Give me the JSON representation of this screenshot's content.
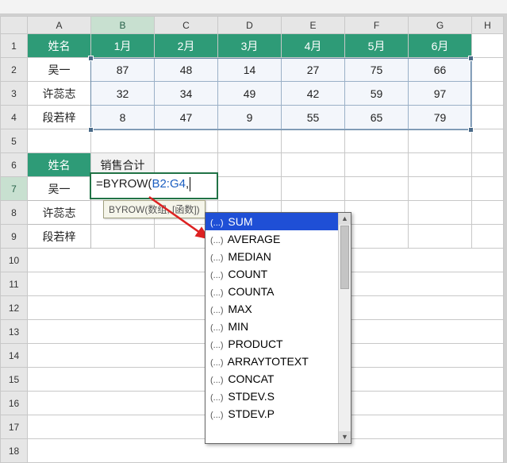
{
  "columns": [
    "A",
    "B",
    "C",
    "D",
    "E",
    "F",
    "G",
    "H"
  ],
  "headers": {
    "name": "姓名",
    "m1": "1月",
    "m2": "2月",
    "m3": "3月",
    "m4": "4月",
    "m5": "5月",
    "m6": "6月"
  },
  "data_rows": [
    {
      "name": "吴一",
      "v": [
        87,
        48,
        14,
        27,
        75,
        66
      ]
    },
    {
      "name": "许蕊志",
      "v": [
        32,
        34,
        49,
        42,
        59,
        97
      ]
    },
    {
      "name": "段若梓",
      "v": [
        8,
        47,
        9,
        55,
        65,
        79
      ]
    }
  ],
  "summary": {
    "name_header": "姓名",
    "total_header": "销售合计",
    "names": [
      "吴一",
      "许蕊志",
      "段若梓"
    ]
  },
  "formula": {
    "prefix": "=BYROW(",
    "ref": "B2:G4",
    "suffix": ","
  },
  "tooltip": "BYROW(数组, [函数])",
  "dropdown": {
    "selected_index": 0,
    "items": [
      "SUM",
      "AVERAGE",
      "MEDIAN",
      "COUNT",
      "COUNTA",
      "MAX",
      "MIN",
      "PRODUCT",
      "ARRAYTOTEXT",
      "CONCAT",
      "STDEV.S",
      "STDEV.P"
    ]
  },
  "chart_data": {
    "type": "table",
    "title": "",
    "columns": [
      "姓名",
      "1月",
      "2月",
      "3月",
      "4月",
      "5月",
      "6月"
    ],
    "rows": [
      [
        "吴一",
        87,
        48,
        14,
        27,
        75,
        66
      ],
      [
        "许蕊志",
        32,
        34,
        49,
        42,
        59,
        97
      ],
      [
        "段若梓",
        8,
        47,
        9,
        55,
        65,
        79
      ]
    ]
  }
}
